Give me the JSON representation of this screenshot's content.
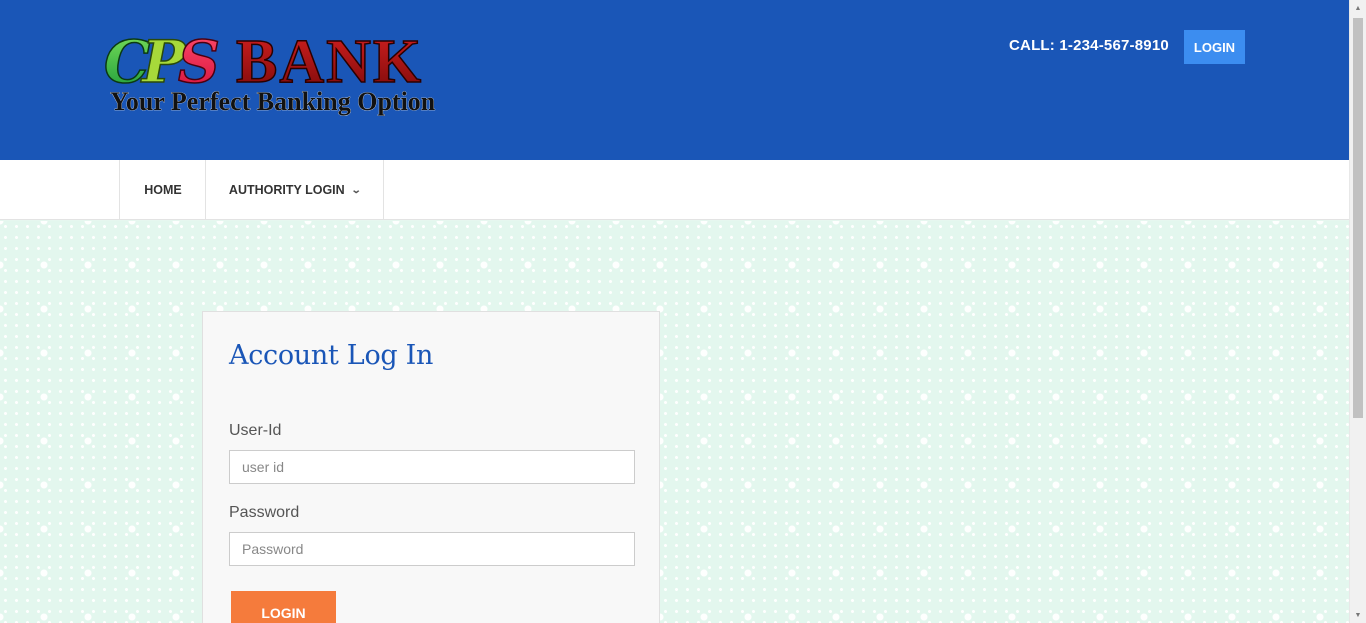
{
  "header": {
    "logo": {
      "brand_cps": "CPS",
      "brand_bank": "BANK",
      "tagline": "Your Perfect Banking Option"
    },
    "call_text": "CALL: 1-234-567-8910",
    "login_label": "LOGIN",
    "bg_color": "#1a56b7"
  },
  "nav": {
    "items": [
      {
        "label": "HOME"
      },
      {
        "label": "AUTHORITY LOGIN",
        "icon": "chevron-down-icon"
      }
    ]
  },
  "login_card": {
    "title": "Account Log In",
    "userid_label": "User-Id",
    "userid_placeholder": "user id",
    "userid_value": "",
    "password_label": "Password",
    "password_placeholder": "Password",
    "password_value": "",
    "submit_label": "LOGIN"
  },
  "colors": {
    "accent_blue": "#1a56b7",
    "login_button": "#3c8df0",
    "submit_button": "#f57b3c",
    "background": "#e3f7ee"
  }
}
